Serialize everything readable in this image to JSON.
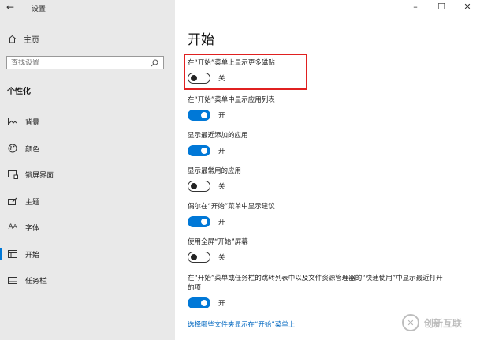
{
  "window": {
    "title": "设置",
    "back_glyph": "←",
    "controls": {
      "minimize": "–",
      "maximize": "☐",
      "close": "✕"
    }
  },
  "sidebar": {
    "home_label": "主页",
    "search": {
      "placeholder": "查找设置",
      "value": ""
    },
    "section_title": "个性化",
    "items": [
      {
        "label": "背景",
        "icon": "picture-icon"
      },
      {
        "label": "颜色",
        "icon": "palette-icon"
      },
      {
        "label": "锁屏界面",
        "icon": "lock-screen-icon"
      },
      {
        "label": "主题",
        "icon": "brush-icon"
      },
      {
        "label": "字体",
        "icon": "font-icon"
      },
      {
        "label": "开始",
        "icon": "start-icon",
        "active": true
      },
      {
        "label": "任务栏",
        "icon": "taskbar-icon"
      }
    ]
  },
  "main": {
    "title": "开始",
    "settings": [
      {
        "label": "在“开始”菜单上显示更多磁贴",
        "state": "关",
        "on": false,
        "highlighted": true
      },
      {
        "label": "在“开始”菜单中显示应用列表",
        "state": "开",
        "on": true
      },
      {
        "label": "显示最近添加的应用",
        "state": "开",
        "on": true
      },
      {
        "label": "显示最常用的应用",
        "state": "关",
        "on": false
      },
      {
        "label": "偶尔在“开始”菜单中显示建议",
        "state": "开",
        "on": true
      },
      {
        "label": "使用全屏“开始”屏幕",
        "state": "关",
        "on": false
      },
      {
        "label": "在“开始”菜单或任务栏的跳转列表中以及文件资源管理器的“快速使用”中显示最近打开的项",
        "state": "开",
        "on": true
      }
    ],
    "link": "选择哪些文件夹显示在“开始”菜单上"
  },
  "watermark": {
    "text": "创新互联"
  },
  "colors": {
    "accent": "#0078d7",
    "highlight": "#e02020",
    "sidebar_bg": "#e9e9e9"
  }
}
